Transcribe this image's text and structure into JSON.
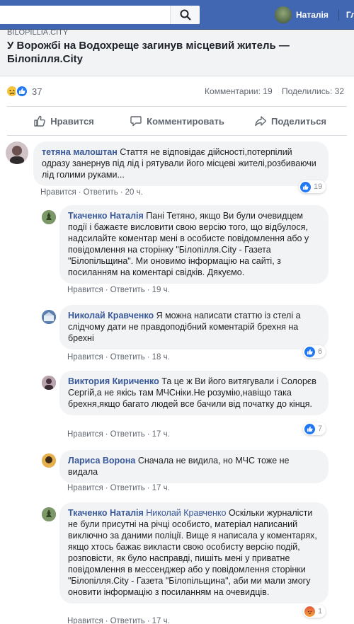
{
  "header": {
    "user_name": "Наталія",
    "home_label": "Гл"
  },
  "post": {
    "domain": "BILOPILLIA.CITY",
    "title": "У Ворожбі на Водохреще загинув місцевий житель — Білопілля.City",
    "reactions_count": "37",
    "comments_text": "Комментарии: 19",
    "shares_text": "Поделились: 32"
  },
  "actions": {
    "like": "Нравится",
    "comment": "Комментировать",
    "share": "Поделиться"
  },
  "comments": [
    {
      "author": "тетяна малоштан",
      "text": "Стаття не відповідає дійсності,потерпілий одразу занернув під лід і рятували його місцеві жителі,розбиваючи лід голими руками...",
      "like_label": "Нравится",
      "reply_label": "Ответить",
      "time": "20 ч.",
      "reactions": "19"
    },
    {
      "author": "Ткаченко Наталія",
      "text": "Пані Тетяно, якщо Ви були очевидцем події і бажаєте висловити свою версію того, що відбулося, надсилайте коментар мені в особисте повідомлення або у повідомлення на сторінку \"Білопілля.City - Газета \"Білопільщина\". Ми оновимо інформацію на сайті, з посиланням на коментарі свідків. Дякуємо.",
      "like_label": "Нравится",
      "reply_label": "Ответить",
      "time": "19 ч."
    },
    {
      "author": "Николай Кравченко",
      "text": "Я можна написати статтю із стелі а слідчому дати не правдоподібний коментарій брехня на брехні",
      "like_label": "Нравится",
      "reply_label": "Ответить",
      "time": "18 ч.",
      "reactions": "6"
    },
    {
      "author": "Виктория Кириченко",
      "text": "Та це ж Ви його витягували і Солорєв Сергій,а не якісь там МЧСніки.Не розумію,навіщо така брехня,якщо багато людей все бачили від початку до кінця.",
      "like_label": "Нравится",
      "reply_label": "Ответить",
      "time": "17 ч.",
      "reactions": "7"
    },
    {
      "author": "Лариса Ворона",
      "text": "Сначала не видила, но МЧС тоже не видала",
      "like_label": "Нравится",
      "reply_label": "Ответить",
      "time": "17 ч."
    },
    {
      "author": "Ткаченко Наталія",
      "mention": "Николай Кравченко",
      "text": "Оскільки журналісти не були присутні на річці особисто, матеріал написаний виключно за даними поліції. Вище я написала у коментарях, якщо хтось бажає викласти свою особисту версію подій, розповісти, як було насправді, пишіть мені у приватне повідомлення в мессенджер або у повідомлення сторінки \"Білопілля.City - Газета \"Білопільщина\", аби ми мали змогу оновити інформацію з посиланням на очевидців.",
      "like_label": "Нравится",
      "reply_label": "Ответить",
      "time": "17 ч.",
      "reactions": "1"
    }
  ]
}
